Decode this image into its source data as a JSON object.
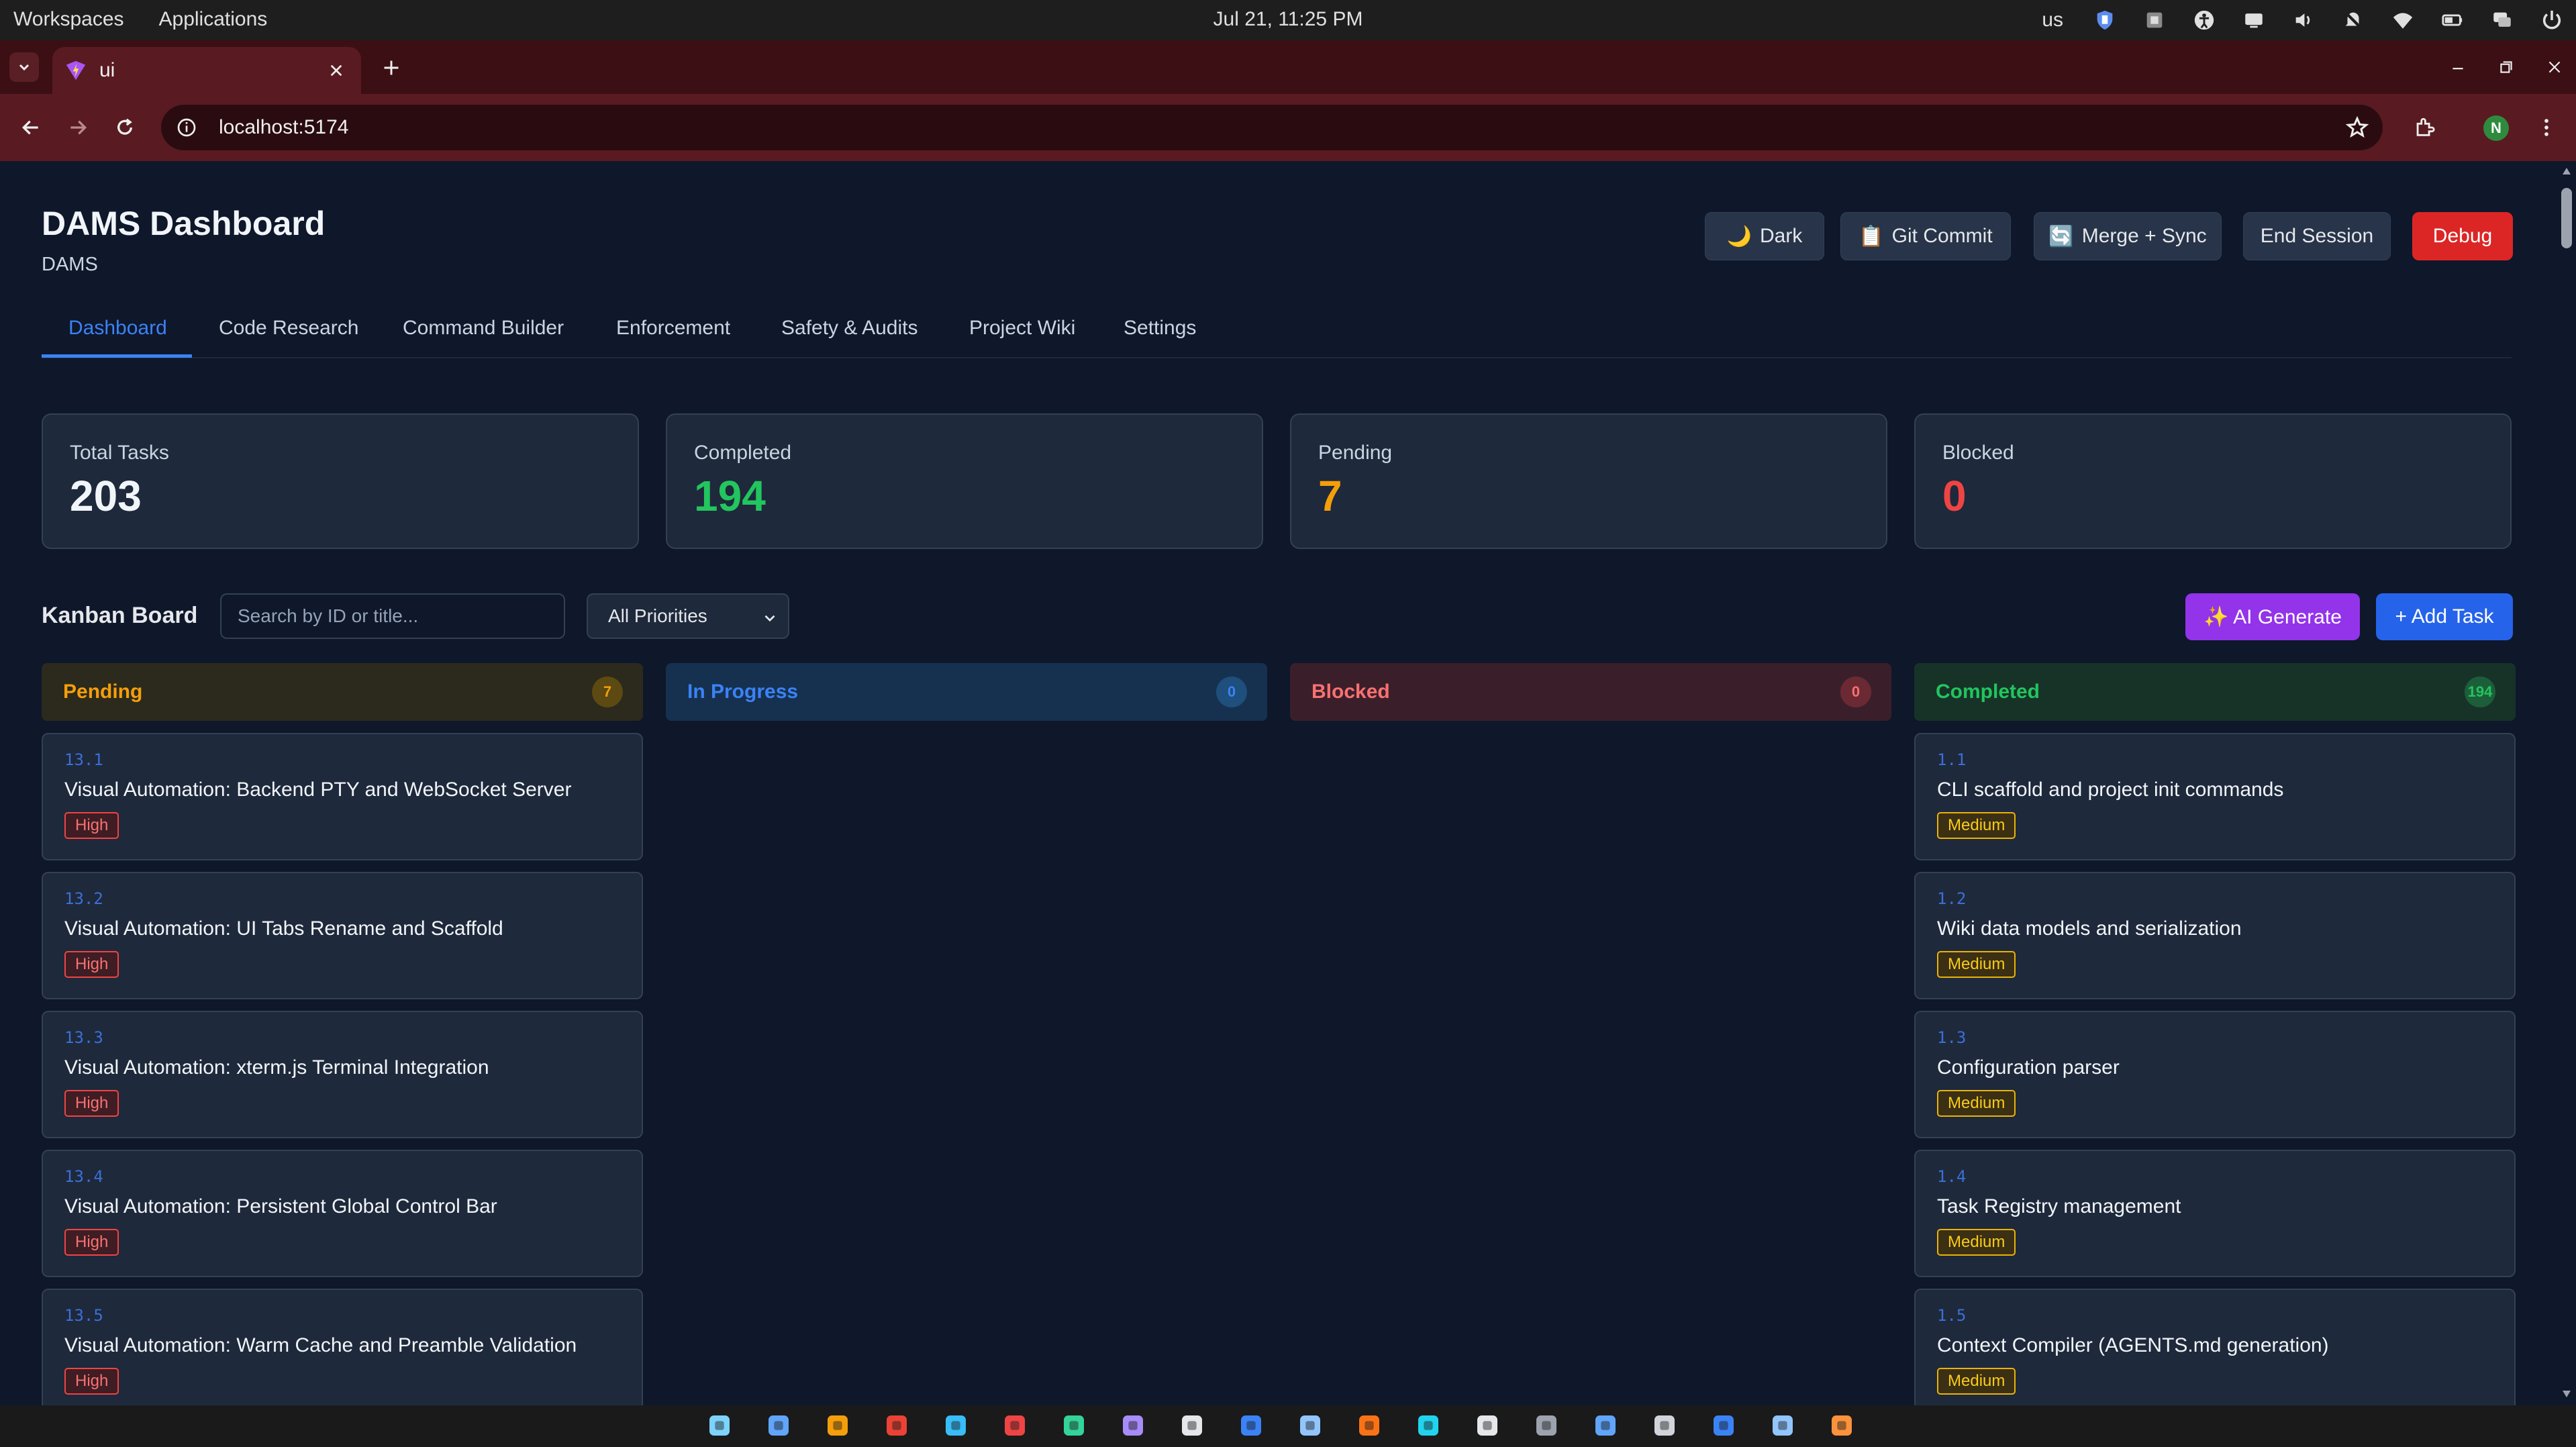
{
  "os": {
    "menu": [
      "Workspaces",
      "Applications"
    ],
    "clock": "Jul 21, 11:25 PM",
    "keyboard_layout": "us",
    "tray_icons": [
      "shield-icon",
      "square-icon",
      "accessibility-icon",
      "display-icon",
      "volume-icon",
      "notifications-off-icon",
      "wifi-icon",
      "battery-icon",
      "chat-icon",
      "power-icon"
    ]
  },
  "browser": {
    "tab_title": "ui",
    "url": "localhost:5174",
    "profile_initial": "N"
  },
  "app": {
    "title": "DAMS Dashboard",
    "subtitle": "DAMS",
    "buttons": {
      "dark": "Dark",
      "git_commit": "Git Commit",
      "merge_sync": "Merge + Sync",
      "end_session": "End Session",
      "debug": "Debug"
    },
    "tabs": [
      "Dashboard",
      "Code Research",
      "Command Builder",
      "Enforcement",
      "Safety & Audits",
      "Project Wiki",
      "Settings"
    ],
    "active_tab": "Dashboard"
  },
  "stats": [
    {
      "label": "Total Tasks",
      "value": "203",
      "color": "#f1f5f9"
    },
    {
      "label": "Completed",
      "value": "194",
      "color": "#22c55e"
    },
    {
      "label": "Pending",
      "value": "7",
      "color": "#f59e0b"
    },
    {
      "label": "Blocked",
      "value": "0",
      "color": "#ef4444"
    }
  ],
  "kanban": {
    "title": "Kanban Board",
    "search_placeholder": "Search by ID or title...",
    "priority_filter": "All Priorities",
    "ai_generate": "✨ AI Generate",
    "add_task": "+ Add Task",
    "columns": [
      {
        "name": "Pending",
        "count": "7",
        "color": "#f59e0b",
        "bg": "#2b2a1c",
        "badge_bg": "#5c4a12",
        "tasks": [
          {
            "id": "13.1",
            "title": "Visual Automation: Backend PTY and WebSocket Server",
            "priority": "High"
          },
          {
            "id": "13.2",
            "title": "Visual Automation: UI Tabs Rename and Scaffold",
            "priority": "High"
          },
          {
            "id": "13.3",
            "title": "Visual Automation: xterm.js Terminal Integration",
            "priority": "High"
          },
          {
            "id": "13.4",
            "title": "Visual Automation: Persistent Global Control Bar",
            "priority": "High"
          },
          {
            "id": "13.5",
            "title": "Visual Automation: Warm Cache and Preamble Validation",
            "priority": "High"
          }
        ]
      },
      {
        "name": "In Progress",
        "count": "0",
        "color": "#3b82f6",
        "bg": "#16314f",
        "badge_bg": "#1e4f7d",
        "tasks": []
      },
      {
        "name": "Blocked",
        "count": "0",
        "color": "#f87171",
        "bg": "#3a1f2a",
        "badge_bg": "#6b2a33",
        "tasks": []
      },
      {
        "name": "Completed",
        "count": "194",
        "color": "#22c55e",
        "bg": "#173328",
        "badge_bg": "#1d5e3a",
        "tasks": [
          {
            "id": "1.1",
            "title": "CLI scaffold and project init commands",
            "priority": "Medium"
          },
          {
            "id": "1.2",
            "title": "Wiki data models and serialization",
            "priority": "Medium"
          },
          {
            "id": "1.3",
            "title": "Configuration parser",
            "priority": "Medium"
          },
          {
            "id": "1.4",
            "title": "Task Registry management",
            "priority": "Medium"
          },
          {
            "id": "1.5",
            "title": "Context Compiler (AGENTS.md generation)",
            "priority": "Medium"
          }
        ]
      }
    ]
  },
  "taskbar_apps": [
    "finder-icon",
    "files-manager-icon",
    "app-grid-icon",
    "chrome-icon",
    "folder-icon",
    "tomato-icon",
    "vpn-icon",
    "github-icon",
    "terminal-alt-icon",
    "calendar-icon",
    "notes-icon",
    "sublime-icon",
    "screenshot-icon",
    "terminal-icon",
    "command-icon",
    "bitwarden-icon",
    "files-icon",
    "vscode-icon",
    "console-icon",
    "firefox-icon"
  ]
}
